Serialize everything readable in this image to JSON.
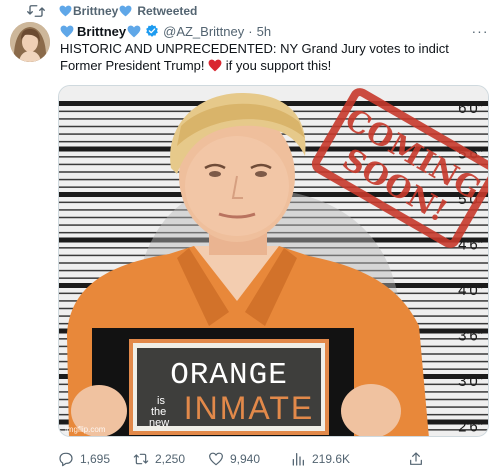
{
  "retweet_banner": {
    "name": "Brittney",
    "suffix": "Retweeted"
  },
  "tweet": {
    "display_name": "Brittney",
    "handle": "@AZ_Brittney",
    "dot": "·",
    "time": "5h",
    "more": "···",
    "text_part1": "HISTORIC AND UNPRECEDENTED: NY Grand Jury votes to indict Former President Trump!",
    "text_part2": "if you support this!"
  },
  "media": {
    "height_labels": [
      "6'0\"",
      "5'6\"",
      "5'0\"",
      "4'6\"",
      "4'0\"",
      "3'6\"",
      "3'0\"",
      "2'6\""
    ],
    "stamp_line1": "COMING",
    "stamp_line2": "SOON!",
    "sign_word1": "ORANGE",
    "sign_small": [
      "is",
      "the",
      "new"
    ],
    "sign_word2": "INMATE",
    "watermark": "imgflip.com"
  },
  "actions": {
    "replies": "1,695",
    "retweets": "2,250",
    "likes": "9,940",
    "views": "219.6K"
  },
  "colors": {
    "heart_blue": "#5fa7e8",
    "heart_red": "#d9252f",
    "verified_blue": "#1d9bf0",
    "stamp_red": "#c7392b",
    "jumpsuit_orange": "#e8883a",
    "sign_orange": "#e2894a",
    "muted_text": "#536471"
  },
  "icons": {
    "retweet": "retweet-icon",
    "reply": "reply-icon",
    "like": "heart-icon",
    "views": "bar-chart-icon",
    "share": "share-icon",
    "verified": "verified-badge-icon"
  }
}
